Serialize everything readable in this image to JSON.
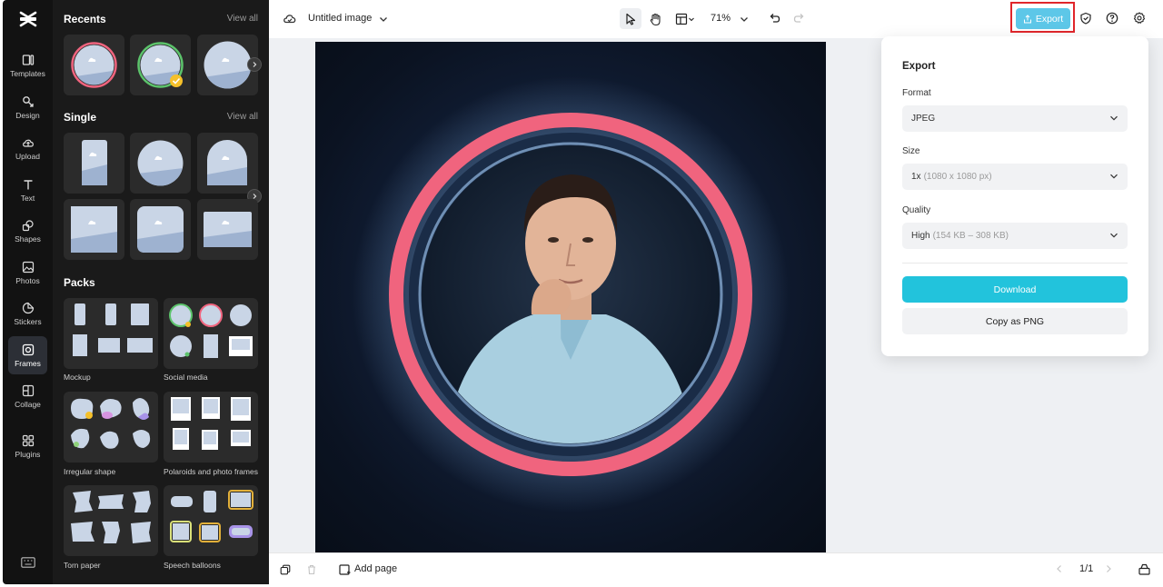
{
  "rail": {
    "items": [
      {
        "label": "Templates",
        "icon": "templates-icon"
      },
      {
        "label": "Design",
        "icon": "design-icon"
      },
      {
        "label": "Upload",
        "icon": "upload-icon"
      },
      {
        "label": "Text",
        "icon": "text-icon"
      },
      {
        "label": "Shapes",
        "icon": "shapes-icon"
      },
      {
        "label": "Photos",
        "icon": "photos-icon"
      },
      {
        "label": "Stickers",
        "icon": "stickers-icon"
      },
      {
        "label": "Frames",
        "icon": "frames-icon",
        "active": true
      },
      {
        "label": "Collage",
        "icon": "collage-icon"
      },
      {
        "label": "Plugins",
        "icon": "plugins-icon"
      }
    ]
  },
  "panel": {
    "recents_title": "Recents",
    "single_title": "Single",
    "packs_title": "Packs",
    "view_all": "View all",
    "packs": [
      {
        "label": "Mockup"
      },
      {
        "label": "Social media"
      },
      {
        "label": "Irregular shape"
      },
      {
        "label": "Polaroids and photo frames"
      },
      {
        "label": "Torn paper"
      },
      {
        "label": "Speech balloons"
      }
    ]
  },
  "topbar": {
    "doc_title": "Untitled image",
    "zoom": "71%",
    "export_label": "Export"
  },
  "bottombar": {
    "add_page": "Add page",
    "page_indicator": "1/1"
  },
  "export_popover": {
    "title": "Export",
    "format_label": "Format",
    "format_value": "JPEG",
    "size_label": "Size",
    "size_value": "1x",
    "size_detail": "(1080 x 1080 px)",
    "quality_label": "Quality",
    "quality_value": "High",
    "quality_detail": "(154 KB – 308 KB)",
    "download_label": "Download",
    "copy_label": "Copy as PNG"
  },
  "colors": {
    "accent": "#22c3dc",
    "export_button": "#5dc7e8",
    "highlight": "#e0262b",
    "frame_ring": "#f0647e",
    "rail_bg": "#121212",
    "panel_bg": "#1a1a1a"
  }
}
